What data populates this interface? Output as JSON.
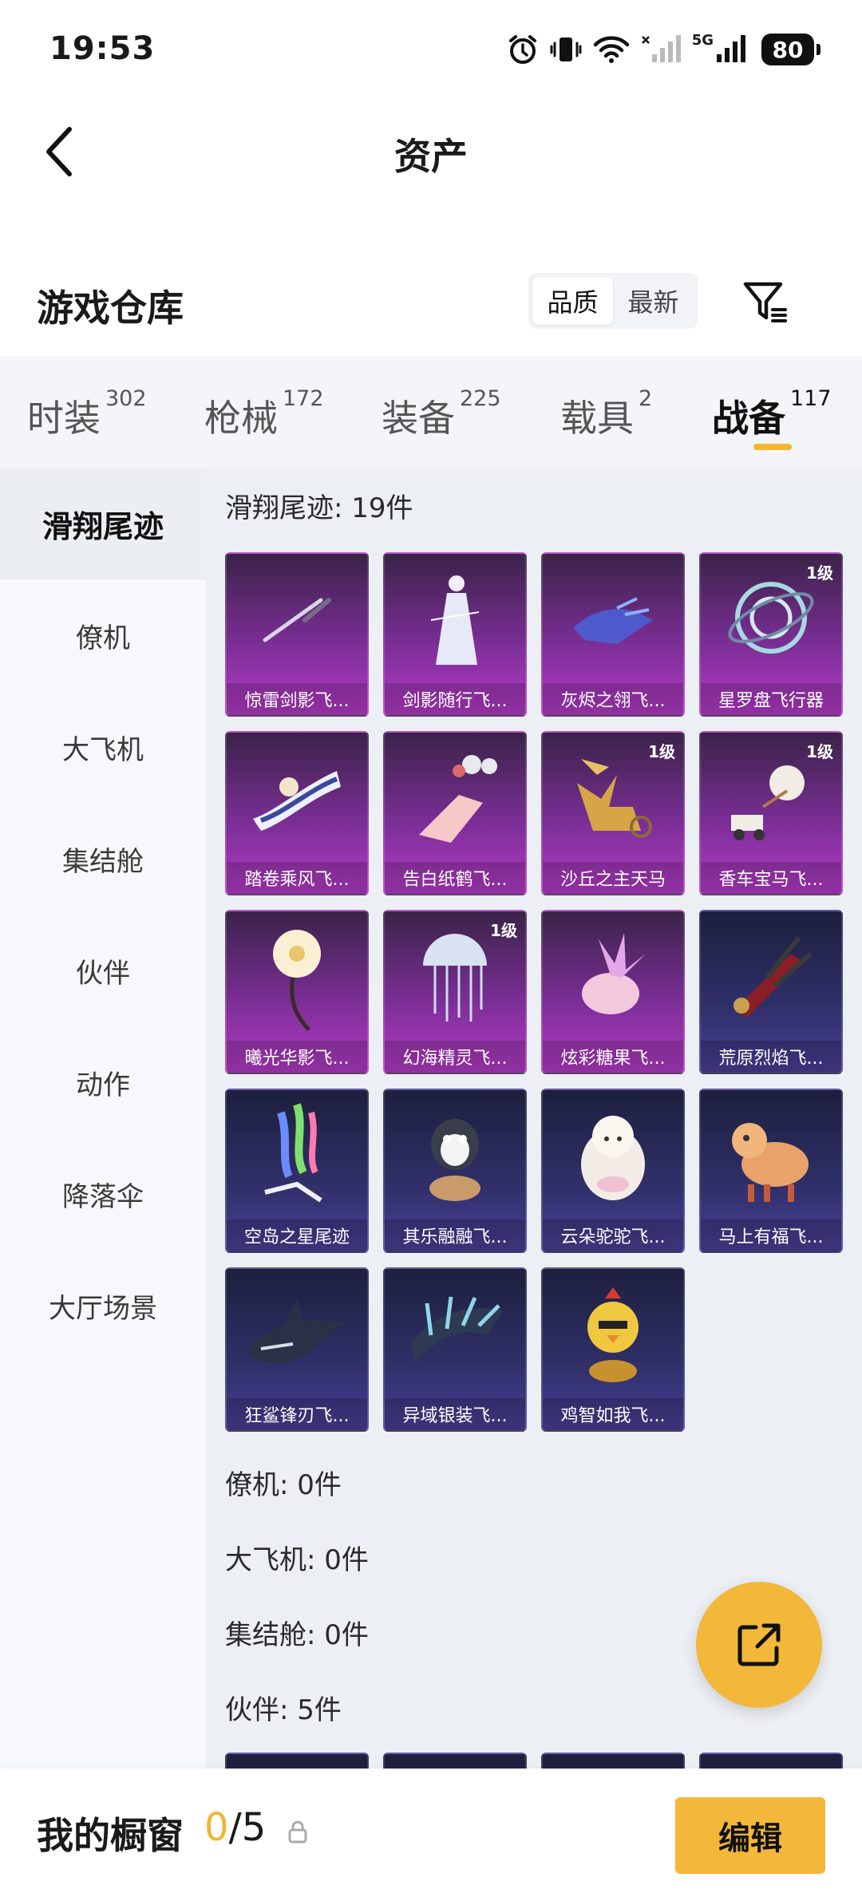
{
  "status": {
    "time": "19:53",
    "network": "5G",
    "battery": "80"
  },
  "header": {
    "title": "资产"
  },
  "warehouse": {
    "title": "游戏仓库",
    "sort_options": [
      "品质",
      "最新"
    ],
    "active_sort": "品质"
  },
  "tabs": [
    {
      "label": "时装",
      "count": "302"
    },
    {
      "label": "枪械",
      "count": "172"
    },
    {
      "label": "装备",
      "count": "225"
    },
    {
      "label": "载具",
      "count": "2"
    },
    {
      "label": "战备",
      "count": "117"
    }
  ],
  "active_tab": "战备",
  "sidebar": {
    "items": [
      "滑翔尾迹",
      "僚机",
      "大飞机",
      "集结舱",
      "伙伴",
      "动作",
      "降落伞",
      "大厅场景"
    ],
    "active": "滑翔尾迹"
  },
  "sections": {
    "glide": {
      "title": "滑翔尾迹: 19件",
      "items": [
        {
          "name": "惊雷剑影飞...",
          "level": "",
          "tier": "rare",
          "icon": "sword-icon"
        },
        {
          "name": "剑影随行飞...",
          "level": "",
          "tier": "rare",
          "icon": "figure-icon"
        },
        {
          "name": "灰烬之翎飞...",
          "level": "",
          "tier": "rare",
          "icon": "glove-icon"
        },
        {
          "name": "星罗盘飞行器",
          "level": "1级",
          "tier": "rare",
          "icon": "compass-icon"
        },
        {
          "name": "踏卷乘风飞...",
          "level": "",
          "tier": "rare",
          "icon": "scroll-icon"
        },
        {
          "name": "告白纸鹤飞...",
          "level": "",
          "tier": "rare",
          "icon": "crane-icon"
        },
        {
          "name": "沙丘之主天马",
          "level": "1级",
          "tier": "rare",
          "icon": "pegasus-icon"
        },
        {
          "name": "香车宝马飞...",
          "level": "1级",
          "tier": "rare",
          "icon": "carriage-icon"
        },
        {
          "name": "曦光华影飞...",
          "level": "",
          "tier": "rare",
          "icon": "flower-icon"
        },
        {
          "name": "幻海精灵飞...",
          "level": "1级",
          "tier": "rare",
          "icon": "jellyfish-icon"
        },
        {
          "name": "炫彩糖果飞...",
          "level": "",
          "tier": "rare",
          "icon": "candy-icon"
        },
        {
          "name": "荒原烈焰飞...",
          "level": "",
          "tier": "epic",
          "icon": "blade-icon"
        },
        {
          "name": "空岛之星尾迹",
          "level": "",
          "tier": "epic",
          "icon": "rainbow-trail-icon"
        },
        {
          "name": "其乐融融飞...",
          "level": "",
          "tier": "epic",
          "icon": "penguin-icon"
        },
        {
          "name": "云朵驼驼飞...",
          "level": "",
          "tier": "epic",
          "icon": "alpaca-icon"
        },
        {
          "name": "马上有福飞...",
          "level": "",
          "tier": "epic",
          "icon": "horse-toy-icon"
        },
        {
          "name": "狂鲨锋刃飞...",
          "level": "",
          "tier": "epic",
          "icon": "shark-icon"
        },
        {
          "name": "异域银装飞...",
          "level": "",
          "tier": "epic",
          "icon": "wing-icon"
        },
        {
          "name": "鸡智如我飞...",
          "level": "",
          "tier": "epic",
          "icon": "chicken-icon"
        }
      ]
    },
    "wingman": {
      "title": "僚机: 0件"
    },
    "bigplane": {
      "title": "大飞机: 0件"
    },
    "pod": {
      "title": "集结舱: 0件"
    },
    "partner": {
      "title": "伙伴: 5件"
    }
  },
  "bottom": {
    "showcase_label": "我的橱窗",
    "used": "0",
    "total": "/5",
    "edit_label": "编辑"
  },
  "colors": {
    "accent": "#f3b73a",
    "rare_card": "#8a32a6",
    "epic_card": "#33336e"
  }
}
